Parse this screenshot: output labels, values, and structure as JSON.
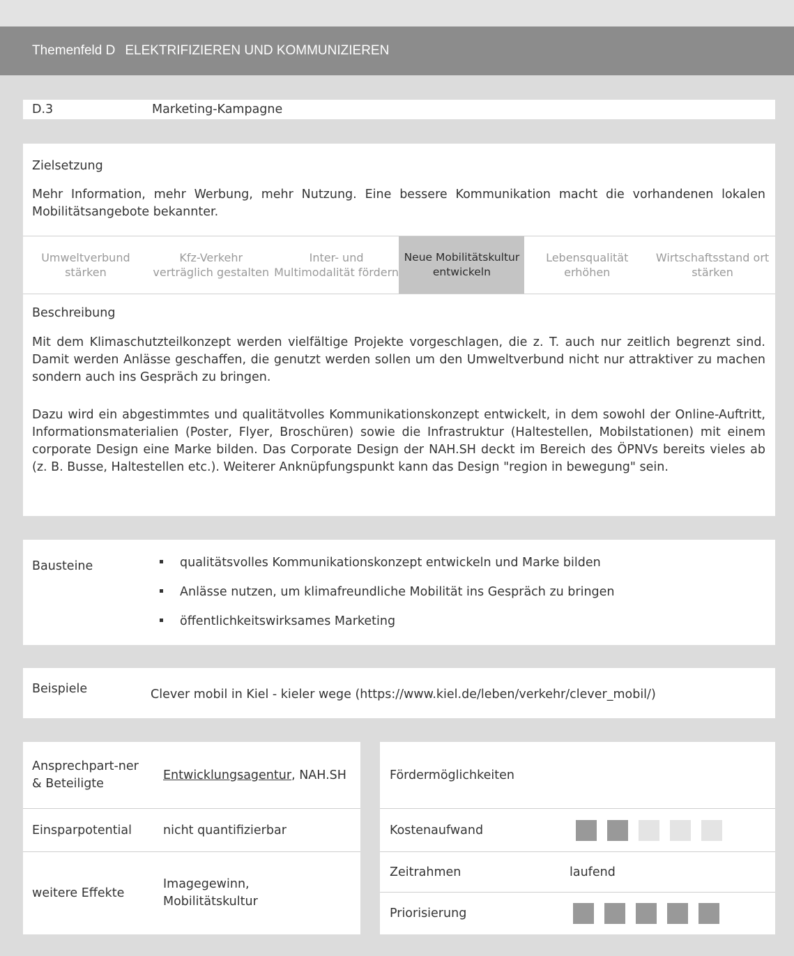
{
  "header": {
    "field_code": "Themenfeld D",
    "field_title": "ELEKTRIFIZIEREN UND KOMMUNIZIEREN"
  },
  "measure": {
    "code": "D.3",
    "title": "Marketing-Kampagne"
  },
  "zielsetzung": {
    "label": "Zielsetzung",
    "text": "Mehr Information, mehr Werbung, mehr Nutzung. Eine bessere Kommunikation macht die vorhandenen lokalen Mobilitätsangebote bekannter."
  },
  "goals": [
    {
      "label": "Umweltverbund stärken",
      "active": false
    },
    {
      "label": "Kfz-Verkehr verträglich gestalten",
      "active": false
    },
    {
      "label": "Inter- und Multimodalität fördern",
      "active": false
    },
    {
      "label": "Neue Mobilitätskultur entwickeln",
      "active": true
    },
    {
      "label": "Lebensqualität erhöhen",
      "active": false
    },
    {
      "label": "Wirtschaftsstand ort stärken",
      "active": false
    }
  ],
  "beschreibung": {
    "label": "Beschreibung",
    "paragraphs": [
      "Mit dem Klimaschutzteilkonzept werden vielfältige Projekte vorgeschlagen, die z. T. auch nur zeitlich begrenzt sind. Damit werden Anlässe geschaffen, die genutzt werden sollen um den Umweltverbund nicht nur attraktiver zu machen sondern auch ins Gespräch zu bringen.",
      "Dazu wird ein abgestimmtes und qualitätvolles Kommunikationskonzept entwickelt, in dem sowohl der Online-Auftritt, Informationsmaterialien (Poster, Flyer, Broschüren) sowie die Infrastruktur (Haltestellen, Mobilstationen) mit einem corporate Design eine Marke bilden. Das Corporate Design der NAH.SH deckt im Bereich des ÖPNVs bereits vieles ab (z. B. Busse, Haltestellen etc.). Weiterer Anknüpfungspunkt kann das Design \"region in bewegung\" sein."
    ]
  },
  "bausteine": {
    "label": "Bausteine",
    "items": [
      "qualitätsvolles Kommunikationskonzept entwickeln und Marke bilden",
      "Anlässe nutzen, um klimafreundliche Mobilität ins Gespräch zu bringen",
      "öffentlichkeitswirksames Marketing"
    ]
  },
  "beispiele": {
    "label": "Beispiele",
    "text": "Clever mobil in Kiel - kieler wege (https://www.kiel.de/leben/verkehr/clever_mobil/)"
  },
  "details_left": {
    "ansprechpartner_label": "Ansprechpart-ner & Beteiligte",
    "ansprechpartner_link": "Entwicklungsagentur",
    "ansprechpartner_rest": ", NAH.SH",
    "einsparpotential_label": "Einsparpotential",
    "einsparpotential_value": "nicht quantifizierbar",
    "effekte_label": "weitere Effekte",
    "effekte_value": "Imagegewinn, Mobilitätskultur"
  },
  "details_right": {
    "foerder_label": "Fördermöglichkeiten",
    "kosten_label": "Kostenaufwand",
    "kosten_level": 2,
    "kosten_max": 5,
    "zeitrahmen_label": "Zeitrahmen",
    "zeitrahmen_value": "laufend",
    "prio_label": "Priorisierung",
    "prio_level": 5,
    "prio_max": 5
  }
}
